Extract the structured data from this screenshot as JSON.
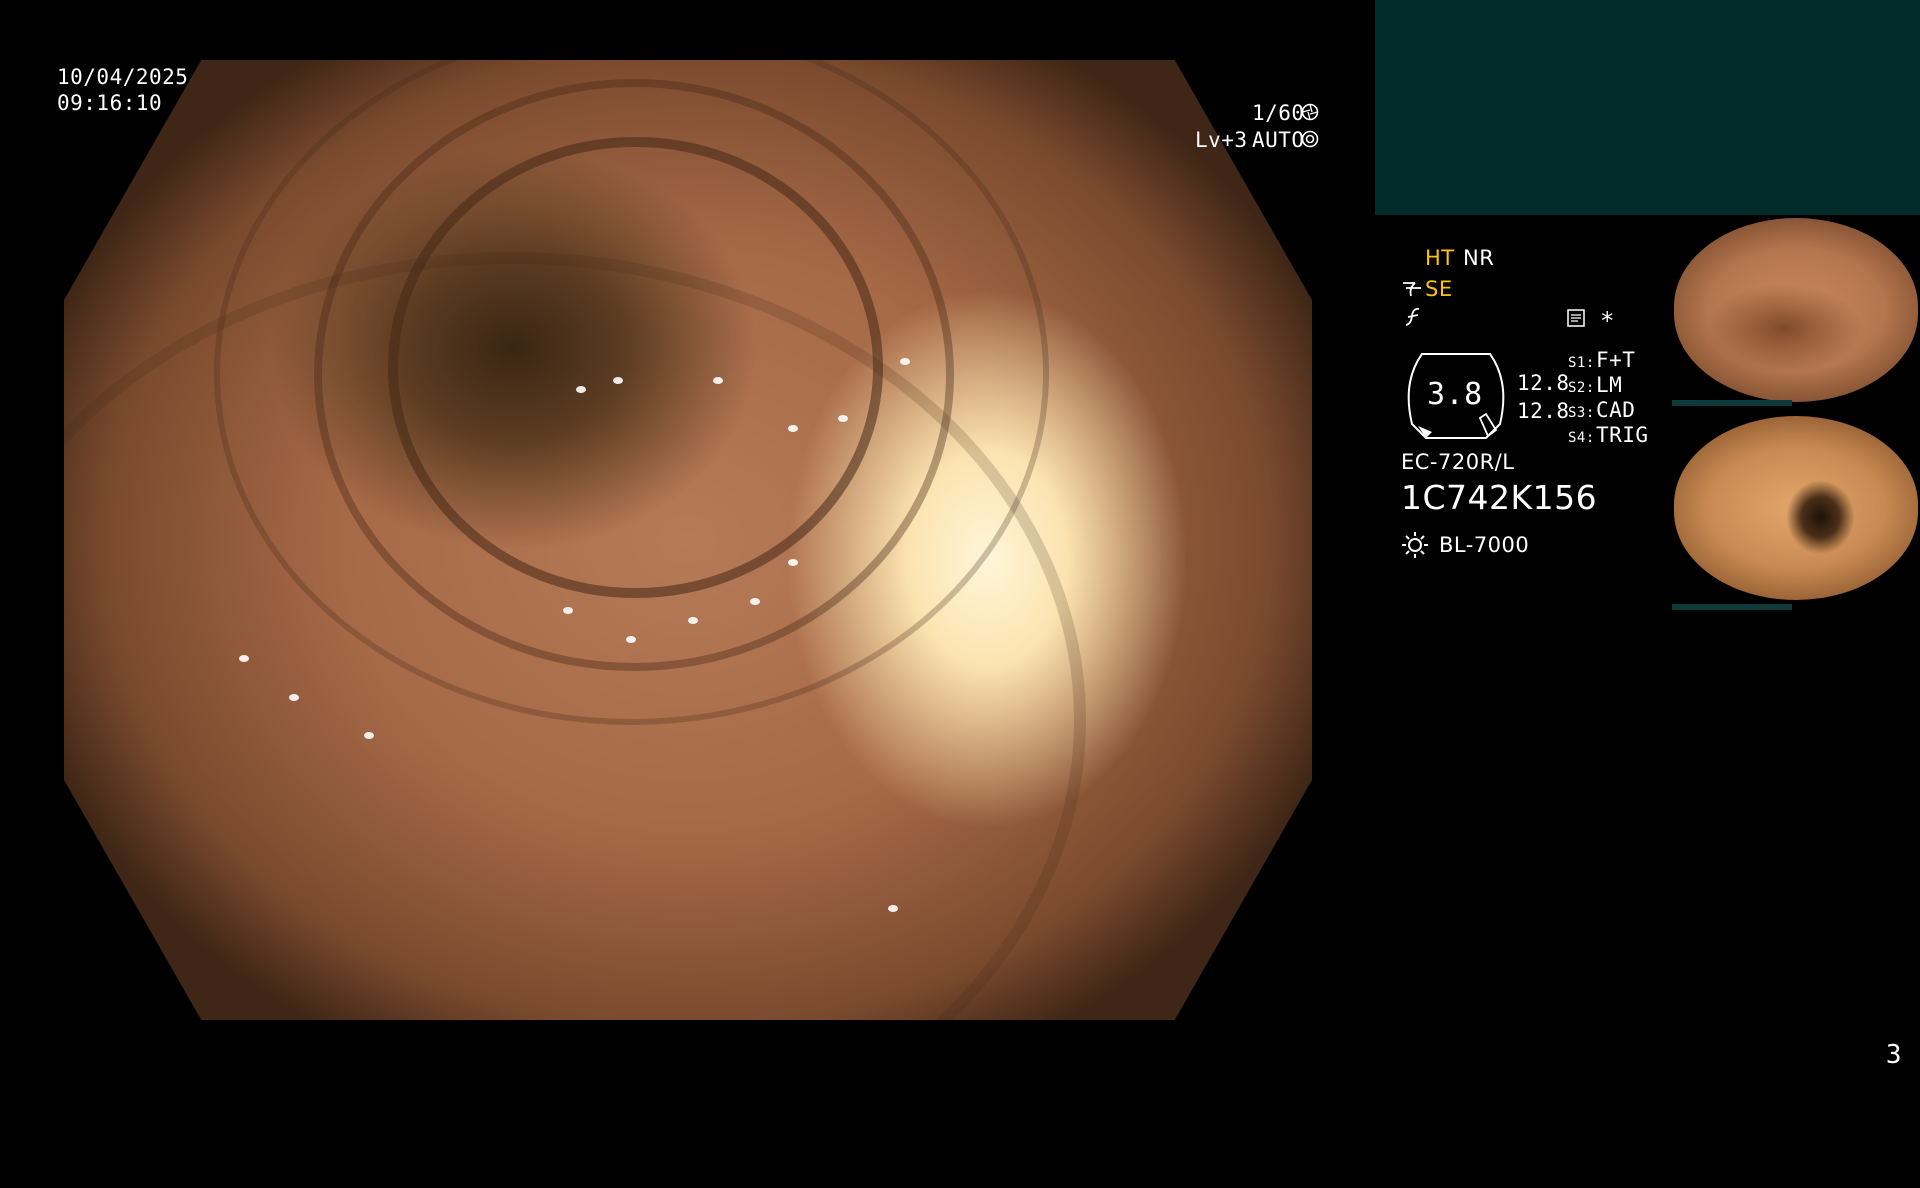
{
  "overlay": {
    "date": "10/04/2025",
    "time": "09:16:10",
    "shutter": "1/60",
    "level": "Lv+3",
    "exposure_mode": "AUTO"
  },
  "panel": {
    "ht_label": "HT",
    "nr_label": "NR",
    "se_label": "SE",
    "lamp_value": "3.8",
    "readout_1": "12.8",
    "readout_2": "12.8",
    "switches": [
      {
        "key": "S1:",
        "value": "F+T"
      },
      {
        "key": "S2:",
        "value": "LM"
      },
      {
        "key": "S3:",
        "value": "CAD"
      },
      {
        "key": "S4:",
        "value": "TRIG"
      }
    ],
    "scope_model": "EC-720R/L",
    "scope_serial": "1C742K156",
    "light_source": "BL-7000",
    "star": "*"
  },
  "footer": {
    "page_number": "3"
  },
  "icons": {
    "shutter_icon": "aperture-icon",
    "exposure_icon": "iris-icon",
    "light_icon": "sun-icon",
    "note_icon": "memo-icon"
  },
  "colors": {
    "highlight": "#ffc400",
    "panel_box": "#002b2b"
  }
}
